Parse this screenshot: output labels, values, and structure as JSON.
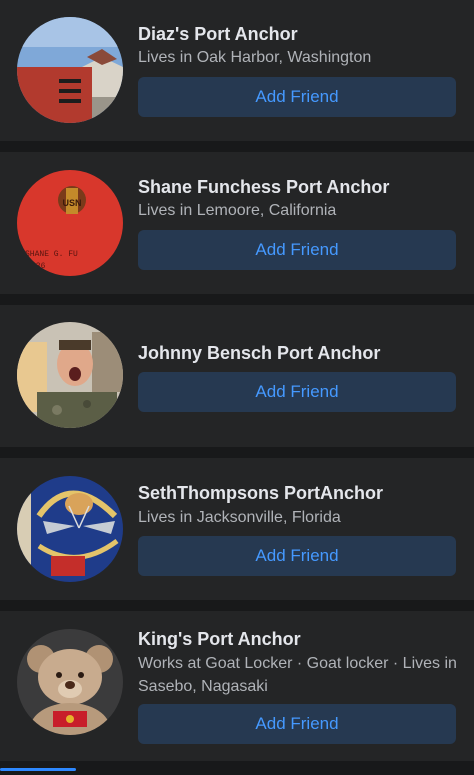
{
  "suggestions": [
    {
      "name": "Diaz's Port Anchor",
      "subtitle": "Lives in Oak Harbor, Washington",
      "button_label": "Add Friend"
    },
    {
      "name": "Shane Funchess Port Anchor",
      "subtitle": "Lives in Lemoore, California",
      "button_label": "Add Friend"
    },
    {
      "name": "Johnny Bensch Port Anchor",
      "subtitle": "",
      "button_label": "Add Friend"
    },
    {
      "name": "SethThompsons PortAnchor",
      "subtitle": "Lives in Jacksonville, Florida",
      "button_label": "Add Friend"
    },
    {
      "name": "King's Port Anchor",
      "subtitle": "Works at Goat Locker · Goat locker · Lives in Sasebo, Nagasaki",
      "button_label": "Add Friend"
    }
  ],
  "colors": {
    "background": "#18191a",
    "card": "#242526",
    "button_bg": "#263951",
    "button_text": "#4599ff",
    "name_text": "#e4e6eb",
    "subtitle_text": "#b0b3b8"
  }
}
